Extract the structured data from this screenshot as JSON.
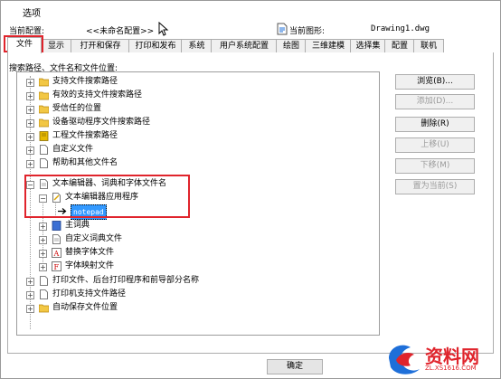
{
  "window": {
    "title": "选项"
  },
  "profile": {
    "current_profile_label": "当前配置:",
    "current_profile_value": "<<未命名配置>>",
    "current_drawing_label": "当前图形:",
    "current_drawing_value": "Drawing1.dwg"
  },
  "tabs": [
    {
      "label": "文件"
    },
    {
      "label": "显示"
    },
    {
      "label": "打开和保存"
    },
    {
      "label": "打印和发布"
    },
    {
      "label": "系统"
    },
    {
      "label": "用户系统配置"
    },
    {
      "label": "绘图"
    },
    {
      "label": "三维建模"
    },
    {
      "label": "选择集"
    },
    {
      "label": "配置"
    },
    {
      "label": "联机"
    }
  ],
  "section_label": "搜索路径、文件名和文件位置:",
  "tree": {
    "items": [
      {
        "label": "支持文件搜索路径",
        "icon": "folder-icon"
      },
      {
        "label": "有效的支持文件搜索路径",
        "icon": "folder-icon"
      },
      {
        "label": "受信任的位置",
        "icon": "folder-icon"
      },
      {
        "label": "设备驱动程序文件搜索路径",
        "icon": "folder-icon"
      },
      {
        "label": "工程文件搜索路径",
        "icon": "book-icon"
      },
      {
        "label": "自定义文件",
        "icon": "file-icon"
      },
      {
        "label": "帮助和其他文件名",
        "icon": "file-icon"
      },
      {
        "label": "文本编辑器、词典和字体文件名",
        "icon": "file-icon"
      },
      {
        "label": "文本编辑器应用程序",
        "icon": "edit-file-icon"
      },
      {
        "label": "notepad",
        "icon": "arrow-icon"
      },
      {
        "label": "主词典",
        "icon": "book-icon"
      },
      {
        "label": "自定义词典文件",
        "icon": "file-icon"
      },
      {
        "label": "替换字体文件",
        "icon": "font-icon"
      },
      {
        "label": "字体映射文件",
        "icon": "font-icon"
      },
      {
        "label": "打印文件、后台打印程序和前导部分名称",
        "icon": "file-icon"
      },
      {
        "label": "打印机支持文件路径",
        "icon": "file-icon"
      },
      {
        "label": "自动保存文件位置",
        "icon": "folder-icon"
      }
    ]
  },
  "buttons": {
    "browse": "浏览(B)...",
    "add": "添加(D)...",
    "remove": "删除(R)",
    "move_up": "上移(U)",
    "move_down": "下移(M)",
    "set_current": "置为当前(S)",
    "ok": "确定"
  },
  "watermark": {
    "text": "资料网",
    "url": "ZL.XS1616.COM"
  },
  "colors": {
    "highlight": "#e0242c",
    "selection": "#3399ff",
    "watermark": "#e0242c"
  }
}
